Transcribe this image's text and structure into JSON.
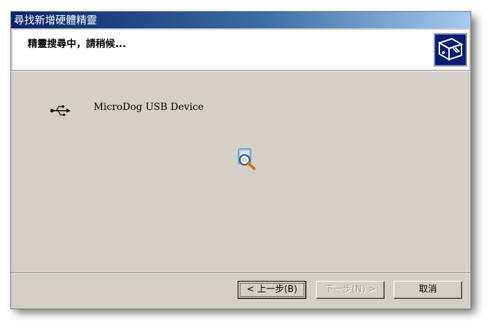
{
  "window": {
    "title": "尋找新增硬體精靈"
  },
  "header": {
    "title": "精靈搜尋中，請稍候..."
  },
  "device": {
    "name": "MicroDog USB Device"
  },
  "buttons": {
    "back": "< 上一步(B)",
    "next": "下一步(N) >",
    "cancel": "取消"
  },
  "icons": {
    "header": "hardware-wizard-icon",
    "device": "usb-icon",
    "progress": "search-magnifier-icon"
  }
}
